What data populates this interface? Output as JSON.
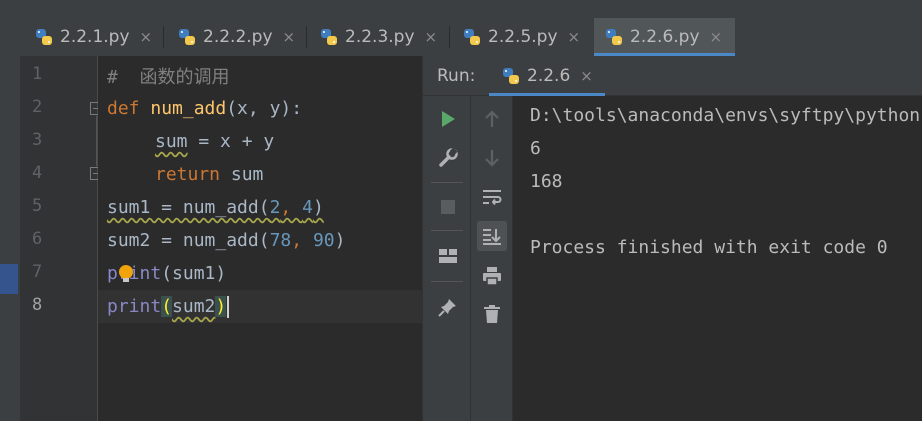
{
  "tabs": [
    {
      "label": "2.2.1.py",
      "active": false
    },
    {
      "label": "2.2.2.py",
      "active": false
    },
    {
      "label": "2.2.3.py",
      "active": false
    },
    {
      "label": "2.2.5.py",
      "active": false
    },
    {
      "label": "2.2.6.py",
      "active": true
    }
  ],
  "close_glyph": "×",
  "gutter": {
    "line_numbers": [
      "1",
      "2",
      "3",
      "4",
      "5",
      "6",
      "7",
      "8"
    ]
  },
  "code": {
    "l1": {
      "comment": "#  函数的调用"
    },
    "l2": {
      "kw": "def",
      "name": "num_add",
      "args": "(x, y):"
    },
    "l3": {
      "var": "sum",
      "rest": " = x + y"
    },
    "l4": {
      "kw": "return",
      "rest": " sum"
    },
    "l5": {
      "pre": "sum1 = num_add(",
      "n1": "2",
      "comma": ", ",
      "n2": "4",
      "post": ")"
    },
    "l6": {
      "pre": "sum2 = num_add(",
      "n1": "78",
      "comma": ", ",
      "n2": "90",
      "post": ")"
    },
    "l7": {
      "fn": "print",
      "args": "(sum1)"
    },
    "l8": {
      "fn": "print",
      "open": "(",
      "arg": "sum2",
      "close": ")"
    }
  },
  "run": {
    "label": "Run:",
    "tab_label": "2.2.6",
    "console": [
      "D:\\tools\\anaconda\\envs\\syftpy\\python.exe",
      "6",
      "168",
      "",
      "Process finished with exit code 0"
    ]
  },
  "colors": {
    "accent": "#4a88c7",
    "run_green": "#59a869",
    "python_blue": "#3f7dbf",
    "python_yellow": "#f2c94c"
  }
}
